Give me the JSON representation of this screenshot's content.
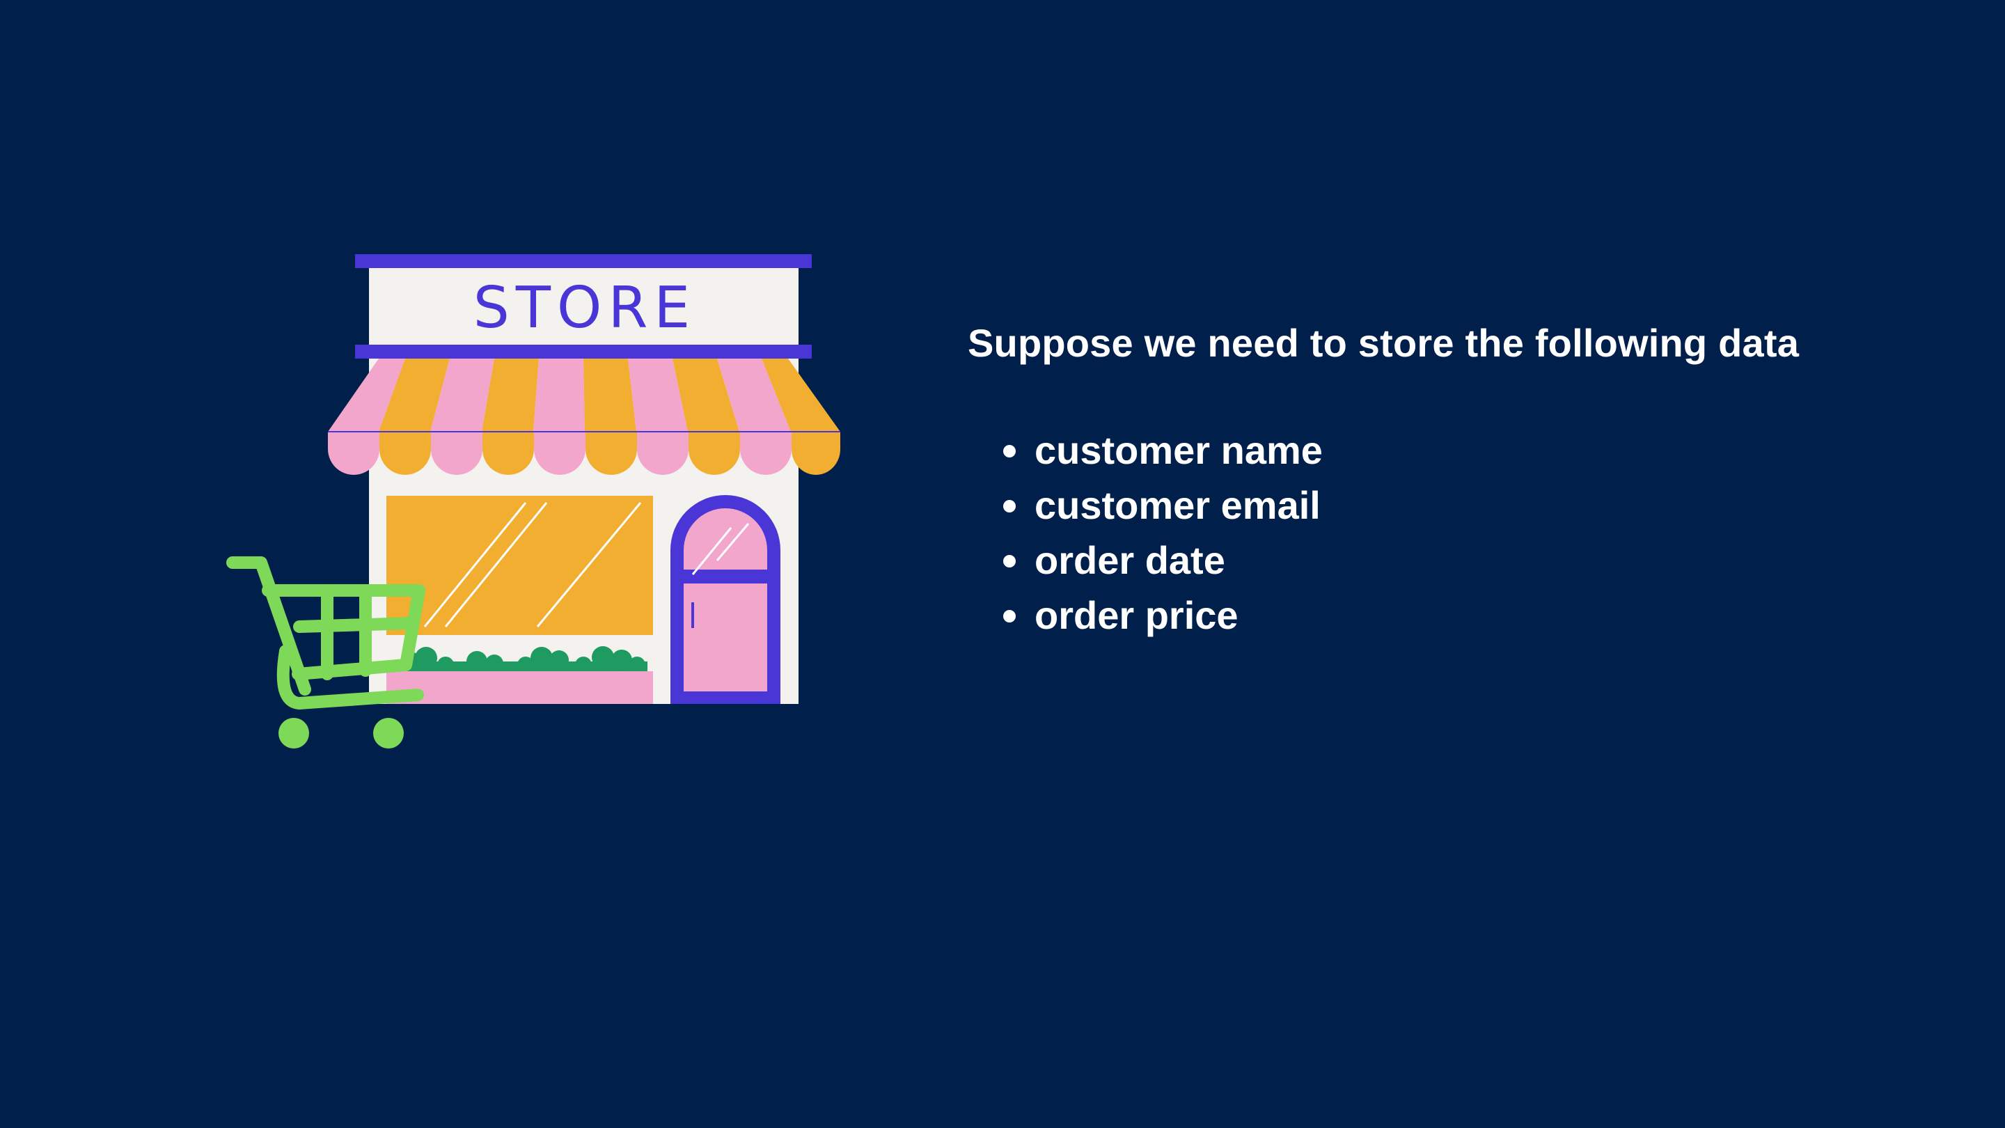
{
  "store_sign": {
    "text": "STORE"
  },
  "main": {
    "heading": "Suppose we need to store the following data",
    "fields": [
      {
        "label": "customer name"
      },
      {
        "label": "customer email"
      },
      {
        "label": "order date"
      },
      {
        "label": "order price"
      }
    ]
  },
  "colors": {
    "background": "#001f4b",
    "text": "#ffffff",
    "store_purple": "#4a35d6",
    "awning_pink": "#f2a6cb",
    "awning_orange": "#f2ae30",
    "cart_green": "#7dd957",
    "plants_green": "#1f9a60",
    "store_wall": "#f3f2ef"
  },
  "icons": [
    "storefront-icon",
    "shopping-cart-icon"
  ]
}
